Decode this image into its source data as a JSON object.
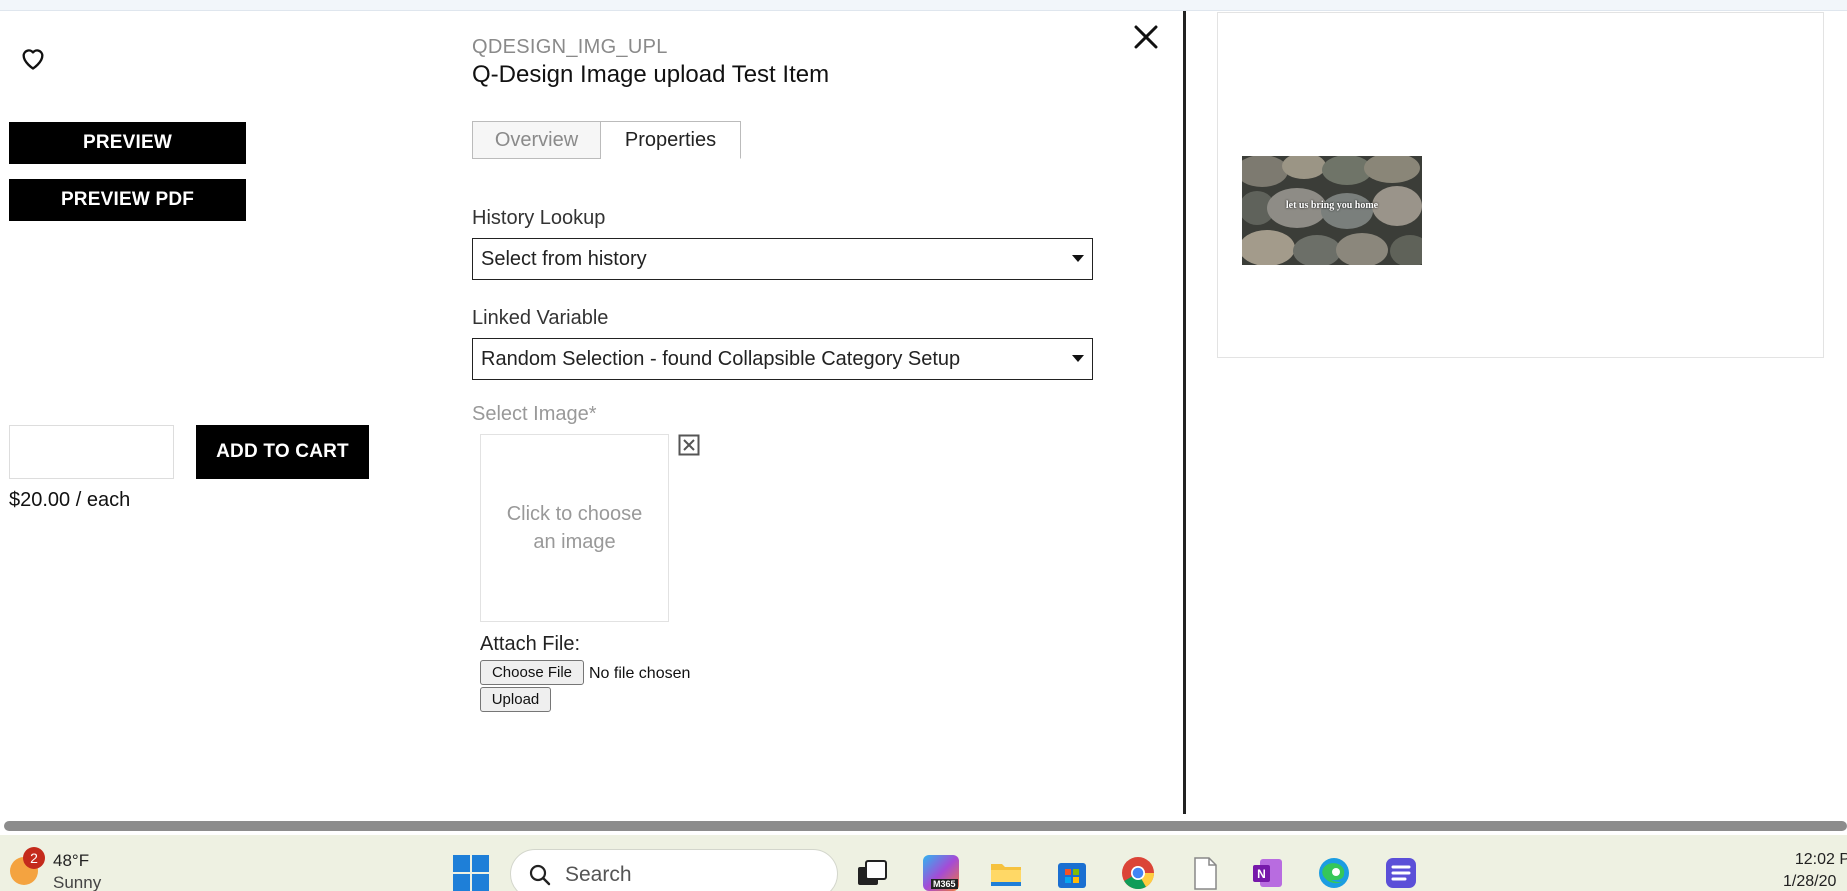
{
  "left": {
    "preview_label": "PREVIEW",
    "preview_pdf_label": "PREVIEW PDF",
    "add_to_cart_label": "ADD TO CART",
    "price": "$20.00 / each"
  },
  "item": {
    "code": "QDESIGN_IMG_UPL",
    "title": "Q-Design Image upload Test Item"
  },
  "tabs": [
    {
      "label": "Overview",
      "active": false
    },
    {
      "label": "Properties",
      "active": true
    }
  ],
  "form": {
    "history_label": "History Lookup",
    "history_value": "Select from history",
    "linked_label": "Linked Variable",
    "linked_value": "Random Selection - found Collapsible Category Setup",
    "select_image_label": "Select Image*",
    "image_placeholder": "Click to choose an image",
    "attach_label": "Attach File:",
    "choose_file_label": "Choose File",
    "no_file_text": "No file chosen",
    "upload_label": "Upload"
  },
  "preview": {
    "image_caption": "let us bring you home"
  },
  "taskbar": {
    "badge_count": "2",
    "temperature": "48°F",
    "condition": "Sunny",
    "search_placeholder": "Search",
    "time": "12:02 P",
    "date": "1/28/20",
    "m365_label": "M365"
  },
  "colors": {
    "button_bg": "#000000",
    "taskbar_bg": "#eef1e2",
    "windows_blue": "#1e7fd8"
  }
}
